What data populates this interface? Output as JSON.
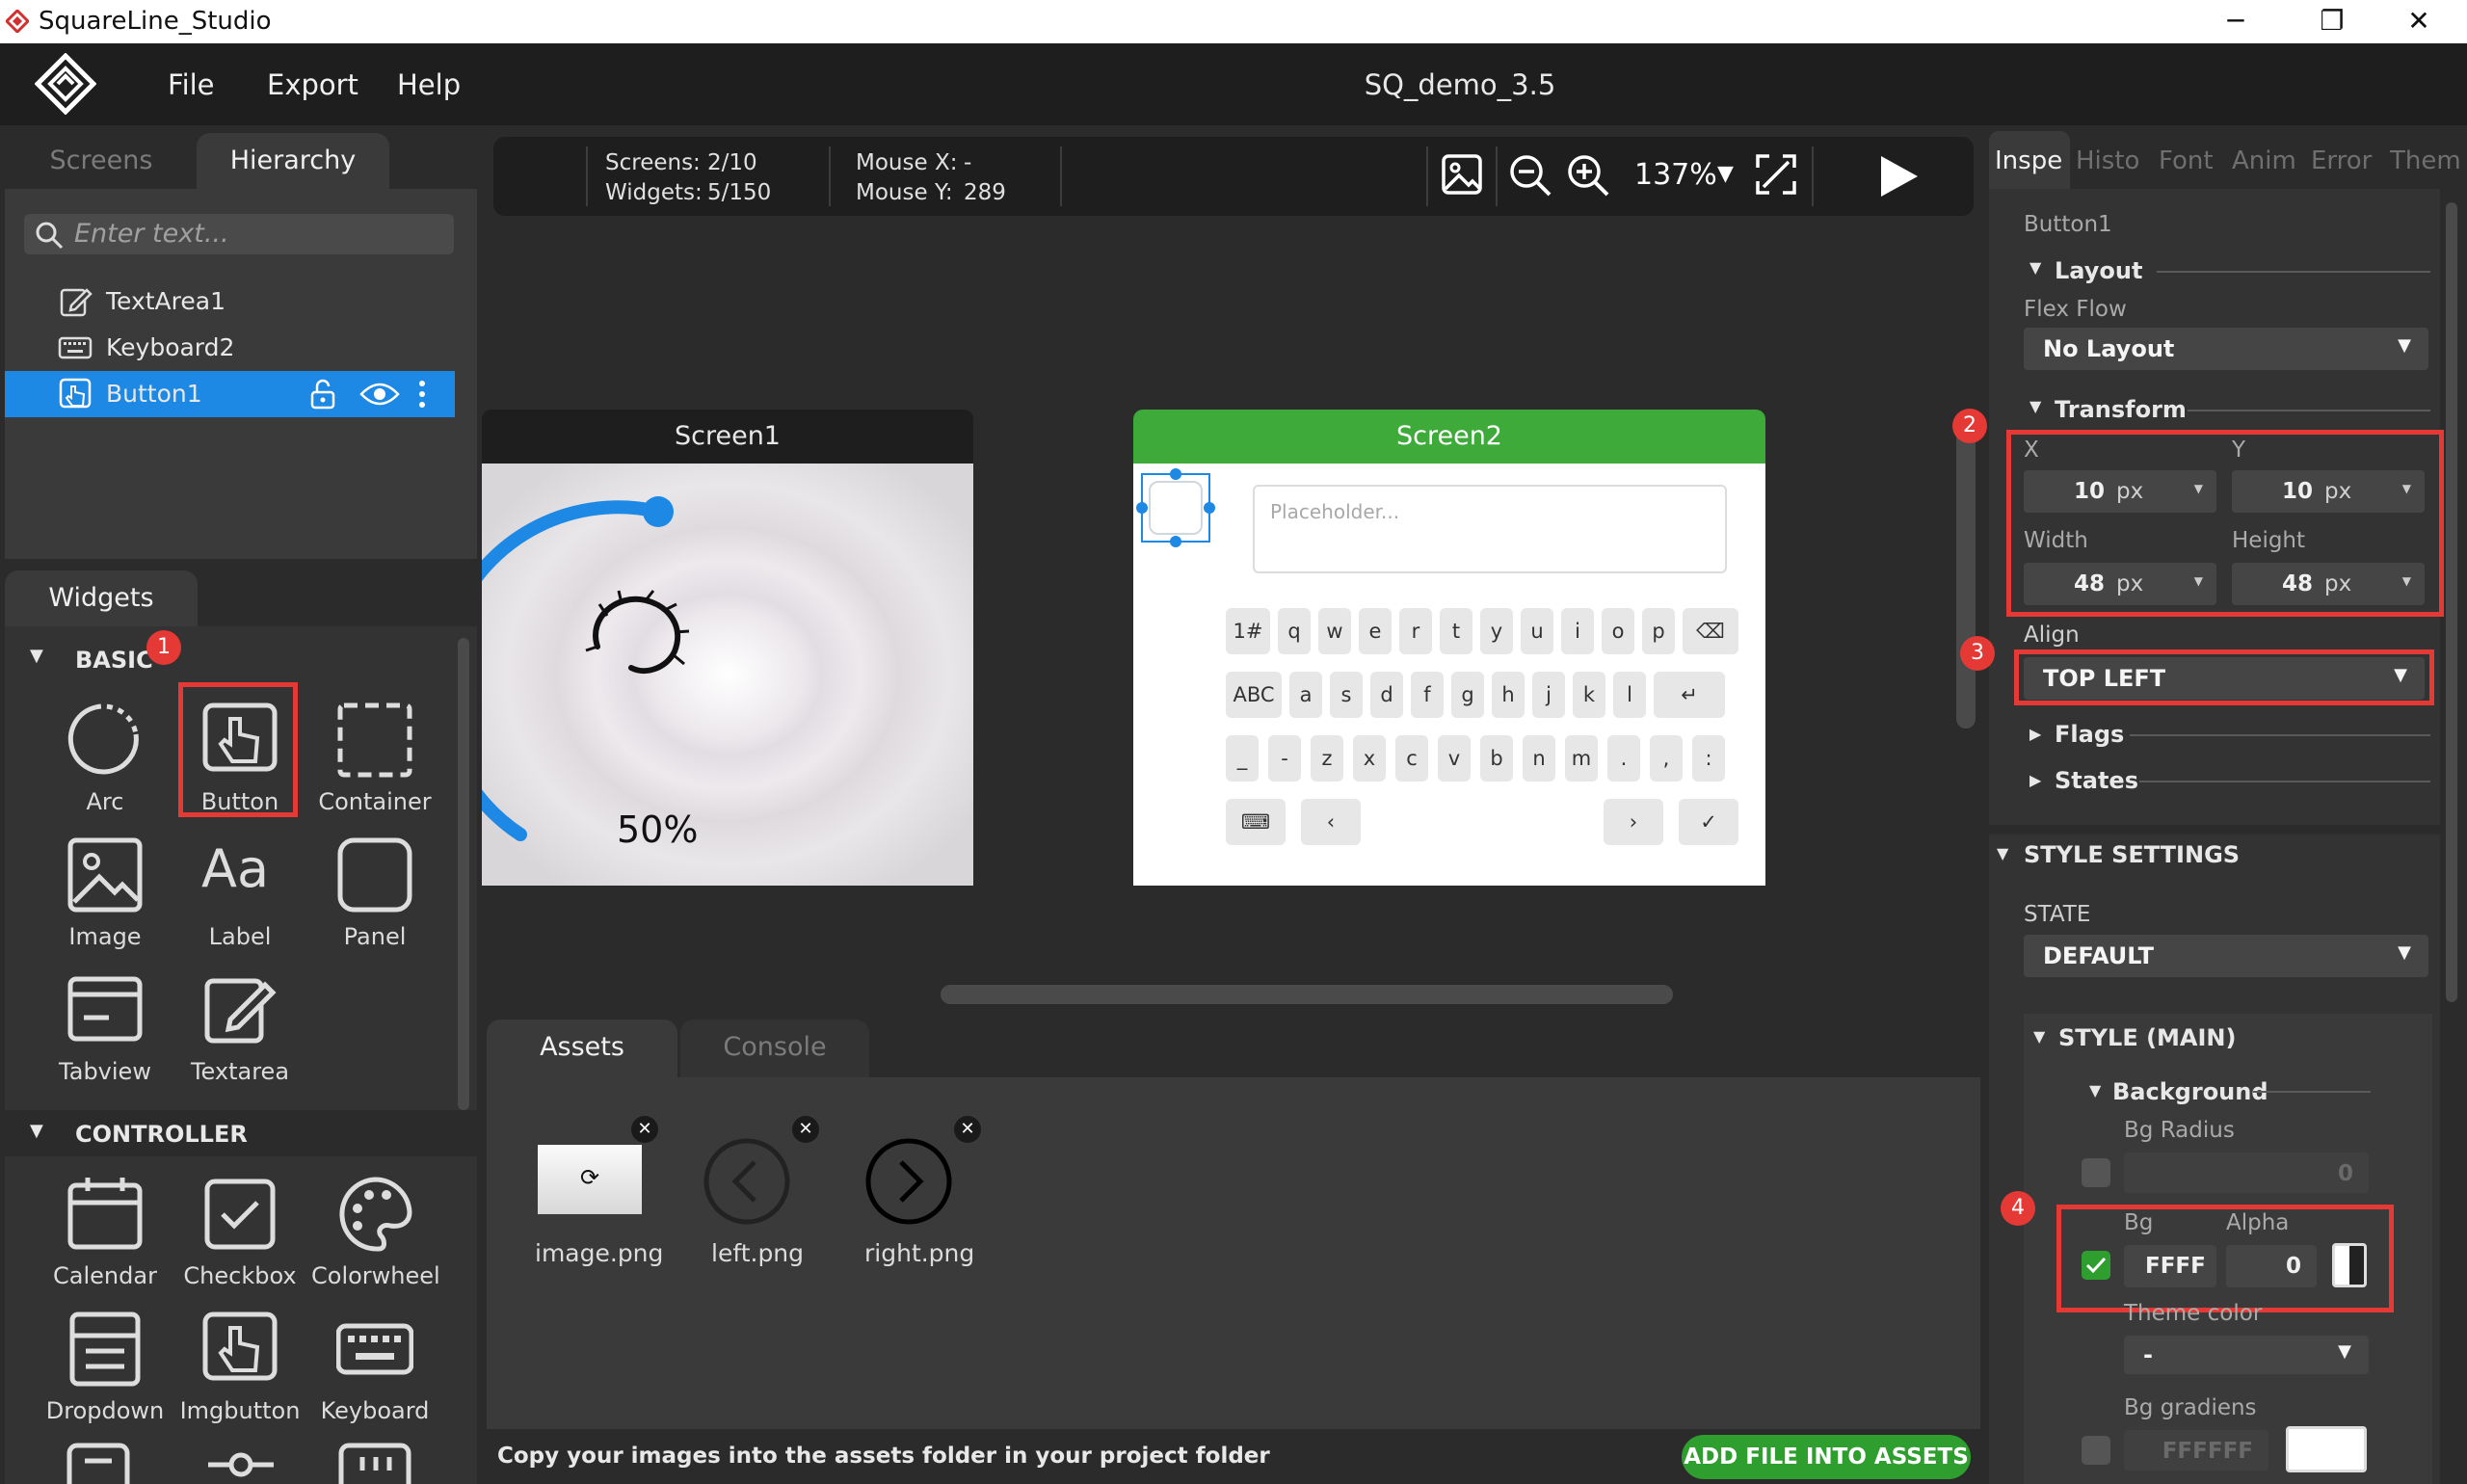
{
  "window": {
    "title": "SquareLine_Studio",
    "minimize": "─",
    "maximize": "❐",
    "close": "✕"
  },
  "menu": {
    "file": "File",
    "export": "Export",
    "help": "Help",
    "project_title": "SQ_demo_3.5"
  },
  "left": {
    "tabs": {
      "screens": "Screens",
      "hierarchy": "Hierarchy"
    },
    "search_placeholder": "Enter text...",
    "hierarchy_items": [
      {
        "label": "TextArea1",
        "icon": "textarea-icon"
      },
      {
        "label": "Keyboard2",
        "icon": "keyboard-icon"
      },
      {
        "label": "Button1",
        "icon": "button-icon"
      }
    ],
    "widgets_tab": "Widgets",
    "basic_label": "BASIC",
    "basic_widgets": [
      "Arc",
      "Button",
      "Container",
      "Image",
      "Label",
      "Panel",
      "Tabview",
      "Textarea"
    ],
    "controller_label": "CONTROLLER",
    "controller_widgets": [
      "Calendar",
      "Checkbox",
      "Colorwheel",
      "Dropdown",
      "Imgbutton",
      "Keyboard"
    ],
    "label_widget_glyph": "Aa"
  },
  "toolbar": {
    "screens_label": "Screens:",
    "screens_value": "2/10",
    "widgets_label": "Widgets:",
    "widgets_value": "5/150",
    "mouse_x_label": "Mouse X:",
    "mouse_x_value": "-",
    "mouse_y_label": "Mouse Y:",
    "mouse_y_value": "289",
    "zoom": "137%"
  },
  "canvas": {
    "screen1_name": "Screen1",
    "screen1_percent": "50%",
    "screen2_name": "Screen2",
    "textarea_placeholder": "Placeholder...",
    "keyboard_rows": [
      [
        "1#",
        "q",
        "w",
        "e",
        "r",
        "t",
        "y",
        "u",
        "i",
        "o",
        "p",
        "⌫"
      ],
      [
        "ABC",
        "a",
        "s",
        "d",
        "f",
        "g",
        "h",
        "j",
        "k",
        "l",
        "↵"
      ],
      [
        "_",
        "-",
        "z",
        "x",
        "c",
        "v",
        "b",
        "n",
        "m",
        ".",
        ",",
        ":"
      ],
      [
        "⌨",
        "‹",
        " ",
        "›",
        "✓"
      ]
    ]
  },
  "bottom": {
    "tabs": {
      "assets": "Assets",
      "console": "Console"
    },
    "assets": [
      "image.png",
      "left.png",
      "right.png"
    ],
    "status_text": "Copy your images into the assets folder in your project folder",
    "add_button": "ADD FILE INTO ASSETS"
  },
  "inspector": {
    "tabs": [
      "Inspe",
      "Histo",
      "Font",
      "Anim",
      "Error",
      "Them"
    ],
    "widget_name": "Button1",
    "layout_label": "Layout",
    "flex_flow_label": "Flex Flow",
    "flex_flow_value": "No Layout",
    "transform_label": "Transform",
    "x_label": "X",
    "x_value": "10",
    "x_unit": "px",
    "y_label": "Y",
    "y_value": "10",
    "y_unit": "px",
    "width_label": "Width",
    "width_value": "48",
    "width_unit": "px",
    "height_label": "Height",
    "height_value": "48",
    "height_unit": "px",
    "align_label": "Align",
    "align_value": "TOP LEFT",
    "flags_label": "Flags",
    "states_label": "States",
    "style_settings_label": "STYLE SETTINGS",
    "state_label": "STATE",
    "state_value": "DEFAULT",
    "style_main_label": "STYLE (MAIN)",
    "background_label": "Background",
    "bg_radius_label": "Bg Radius",
    "bg_radius_value": "0",
    "bg_label": "Bg",
    "bg_value": "FFFF",
    "alpha_label": "Alpha",
    "alpha_value": "0",
    "theme_color_label": "Theme color",
    "theme_color_value": "-",
    "bg_gradients_label": "Bg gradiens",
    "bg_gradients_value": "FFFFFF"
  },
  "annotations": [
    "1",
    "2",
    "3",
    "4"
  ],
  "colors": {
    "accent": "#1e88e5",
    "screen2_header": "#3daa3a",
    "highlight": "#e53935",
    "add_button": "#2e9e2e"
  }
}
